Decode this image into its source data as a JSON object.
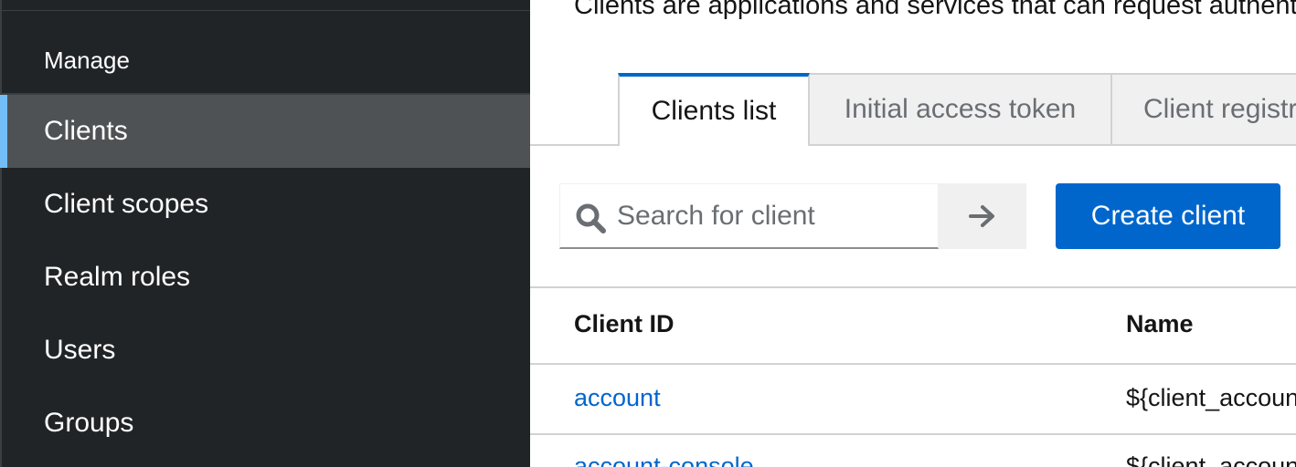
{
  "sidebar": {
    "group_title": "Manage",
    "items": [
      {
        "label": "Clients",
        "active": true
      },
      {
        "label": "Client scopes",
        "active": false
      },
      {
        "label": "Realm roles",
        "active": false
      },
      {
        "label": "Users",
        "active": false
      },
      {
        "label": "Groups",
        "active": false
      }
    ]
  },
  "page": {
    "description": "Clients are applications and services that can request authentication of a user."
  },
  "tabs": [
    {
      "label": "Clients list",
      "active": true
    },
    {
      "label": "Initial access token",
      "active": false
    },
    {
      "label": "Client registration",
      "active": false
    }
  ],
  "toolbar": {
    "search_placeholder": "Search for client",
    "search_icon": "search-icon",
    "go_icon": "arrow-right-icon",
    "create_label": "Create client"
  },
  "table": {
    "columns": [
      "Client ID",
      "Name"
    ],
    "rows": [
      {
        "client_id": "account",
        "name": "${client_account}"
      },
      {
        "client_id": "account-console",
        "name": "${client_account-console}"
      }
    ]
  },
  "colors": {
    "sidebar_bg": "#212427",
    "active_item_bg": "#4f5255",
    "active_indicator": "#73bcf7",
    "primary": "#0066cc"
  }
}
